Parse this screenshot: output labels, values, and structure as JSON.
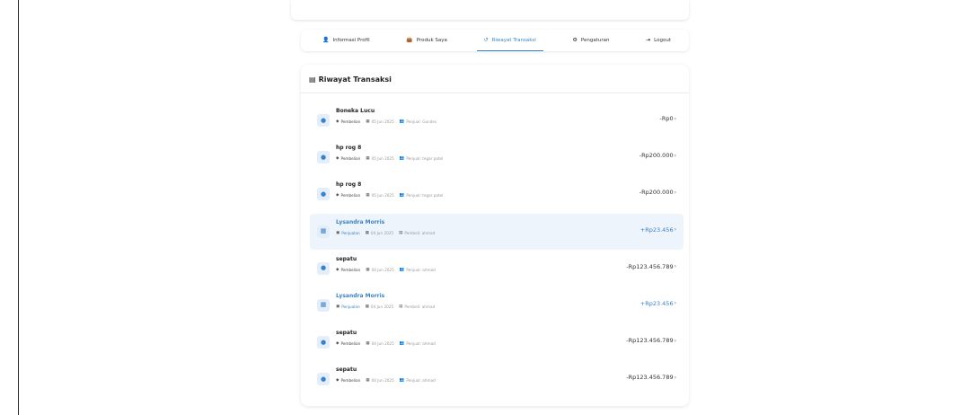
{
  "tabs": [
    {
      "label": "Informasi Profil",
      "icon": "user-icon",
      "glyph": "👤",
      "active": false
    },
    {
      "label": "Produk Saya",
      "icon": "bag-icon",
      "glyph": "👜",
      "active": false
    },
    {
      "label": "Riwayat Transaksi",
      "icon": "history-icon",
      "glyph": "↺",
      "active": true
    },
    {
      "label": "Pengaturan",
      "icon": "gear-icon",
      "glyph": "⚙",
      "active": false
    },
    {
      "label": "Logout",
      "icon": "logout-icon",
      "glyph": "⇥",
      "active": false
    }
  ],
  "panel": {
    "title": "Riwayat Transaksi",
    "title_icon": "receipt-icon",
    "title_glyph": "▤"
  },
  "transactions": [
    {
      "name": "Boneka Lucu",
      "type": "Pembelian",
      "date": "05 Jun 2025",
      "party": "Penjual: Gandes",
      "amount": "-Rp0",
      "kind": "purchase"
    },
    {
      "name": "hp rog 8",
      "type": "Pembelian",
      "date": "05 Jun 2025",
      "party": "Penjual: tegar patel",
      "amount": "-Rp200.000",
      "kind": "purchase"
    },
    {
      "name": "hp rog 8",
      "type": "Pembelian",
      "date": "05 Jun 2025",
      "party": "Penjual: tegar patel",
      "amount": "-Rp200.000",
      "kind": "purchase"
    },
    {
      "name": "Lysandra Morris",
      "type": "Penjualan",
      "date": "04 Jun 2025",
      "party": "Pembeli: ahmad",
      "amount": "+Rp23.456",
      "kind": "sale",
      "highlight": true
    },
    {
      "name": "sepatu",
      "type": "Pembelian",
      "date": "04 Jun 2025",
      "party": "Penjual: ahmad",
      "amount": "-Rp123.456.789",
      "kind": "purchase"
    },
    {
      "name": "Lysandra Morris",
      "type": "Penjualan",
      "date": "04 Jun 2025",
      "party": "Pembeli: ahmad",
      "amount": "+Rp23.456",
      "kind": "sale"
    },
    {
      "name": "sepatu",
      "type": "Pembelian",
      "date": "04 Jun 2025",
      "party": "Penjual: ahmad",
      "amount": "-Rp123.456.789",
      "kind": "purchase"
    },
    {
      "name": "sepatu",
      "type": "Pembelian",
      "date": "04 Jun 2025",
      "party": "Penjual: ahmad",
      "amount": "-Rp123.456.789",
      "kind": "purchase"
    }
  ],
  "colors": {
    "accent": "#3b82c4",
    "highlight_bg": "#eef4fb"
  }
}
